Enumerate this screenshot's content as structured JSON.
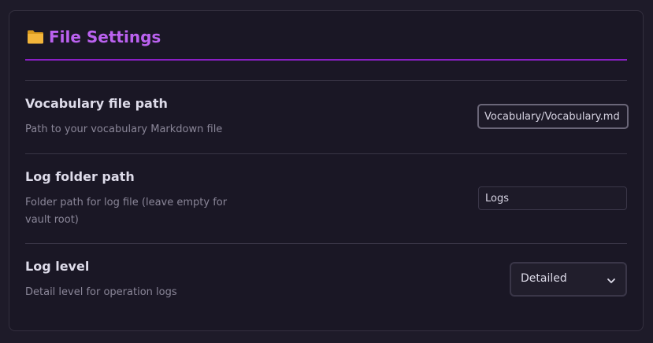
{
  "header": {
    "icon": "folder-icon",
    "title": "File Settings",
    "accent_color": "#8a1fc5",
    "title_color": "#bb62f0"
  },
  "settings": [
    {
      "name": "Vocabulary file path",
      "description": "Path to your vocabulary Markdown file",
      "value": "Vocabulary/Vocabulary.md",
      "control": "text",
      "focused": true
    },
    {
      "name": "Log folder path",
      "description": "Folder path for log file (leave empty for vault root)",
      "value": "Logs",
      "control": "text",
      "focused": false
    },
    {
      "name": "Log level",
      "description": "Detail level for operation logs",
      "value": "Detailed",
      "control": "dropdown",
      "icon": "chevron-down-icon"
    }
  ]
}
